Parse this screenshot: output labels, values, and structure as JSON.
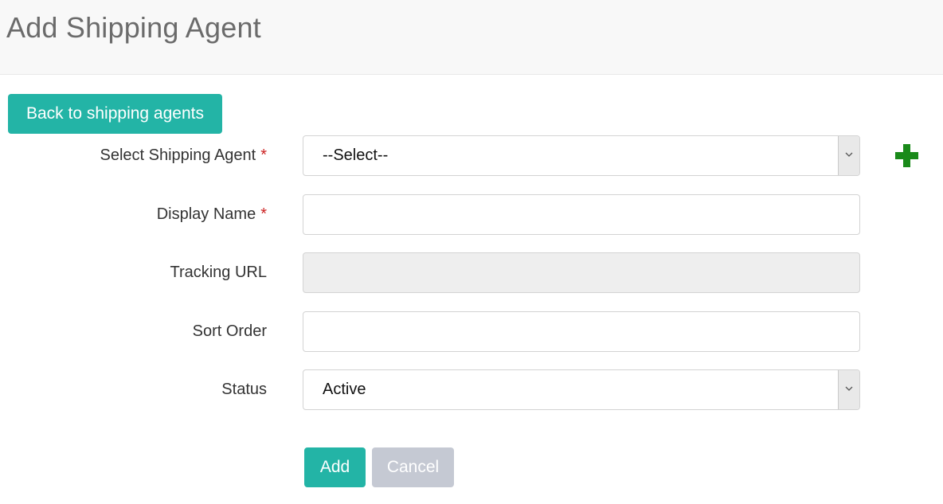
{
  "header": {
    "title": "Add Shipping Agent"
  },
  "back_button": {
    "label": "Back to shipping agents"
  },
  "form": {
    "required_marker": "*",
    "shipping_agent": {
      "label": "Select Shipping Agent",
      "selected": "--Select--",
      "required": true
    },
    "display_name": {
      "label": "Display Name",
      "value": "",
      "required": true
    },
    "tracking_url": {
      "label": "Tracking URL",
      "value": "",
      "disabled": true
    },
    "sort_order": {
      "label": "Sort Order",
      "value": ""
    },
    "status": {
      "label": "Status",
      "selected": "Active"
    }
  },
  "actions": {
    "add_label": "Add",
    "cancel_label": "Cancel"
  },
  "icons": {
    "add_agent": "plus-icon",
    "dropdown": "chevron-down-icon"
  },
  "colors": {
    "primary": "#23b4a6",
    "disabled_button": "#c5c9d3",
    "required": "#cc2222",
    "plus_icon": "#1a8a1a",
    "header_bg": "#f8f8f8"
  }
}
